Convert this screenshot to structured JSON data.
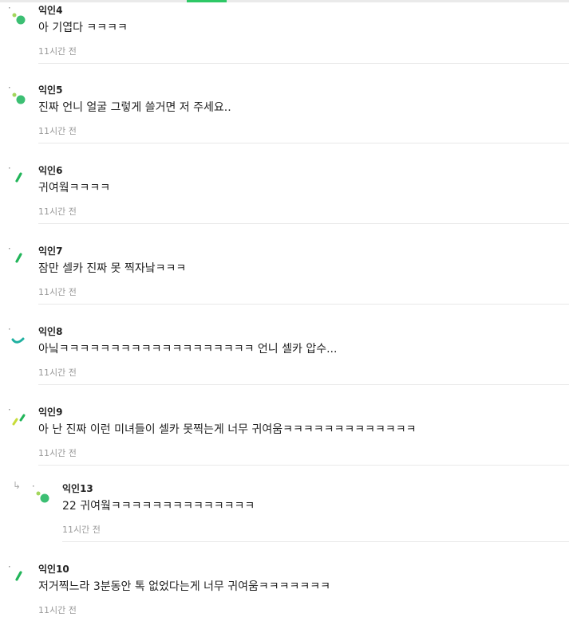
{
  "comments": [
    {
      "author": "익인4",
      "text": "아 기엽다 ㅋㅋㅋㅋ",
      "time": "11시간 전",
      "avatar": "dots-avatar-icon"
    },
    {
      "author": "익인5",
      "text": "진짜 언니 얼굴 그렇게 쓸거면 저 주세요..",
      "time": "11시간 전",
      "avatar": "dots-avatar-icon"
    },
    {
      "author": "익인6",
      "text": "귀여웤ㅋㅋㅋㅋ",
      "time": "11시간 전",
      "avatar": "slash-avatar-icon"
    },
    {
      "author": "익인7",
      "text": "잠만 셀카 진짜 못 찍자낰ㅋㅋㅋ",
      "time": "11시간 전",
      "avatar": "slash-avatar-icon"
    },
    {
      "author": "익인8",
      "text": "아닠ㅋㅋㅋㅋㅋㅋㅋㅋㅋㅋㅋㅋㅋㅋㅋㅋㅋㅋㅋ 언니 셀카 압수...",
      "time": "11시간 전",
      "avatar": "arc-avatar-icon"
    },
    {
      "author": "익인9",
      "text": "아 난 진짜 이런 미녀들이 셀카 못찍는게 너무 귀여움ㅋㅋㅋㅋㅋㅋㅋㅋㅋㅋㅋㅋㅋ",
      "time": "11시간 전",
      "avatar": "double-slash-avatar-icon"
    },
    {
      "author": "익인13",
      "text": "22 귀여웤ㅋㅋㅋㅋㅋㅋㅋㅋㅋㅋㅋㅋㅋㅋ",
      "time": "11시간 전",
      "avatar": "dots-avatar-icon",
      "is_reply": true
    },
    {
      "author": "익인10",
      "text": "저거찍느라 3분동안 톡 없었다는게 너무 귀여움ㅋㅋㅋㅋㅋㅋㅋ",
      "time": "11시간 전",
      "avatar": "slash-avatar-icon"
    }
  ],
  "colors": {
    "accent": "#2ec866",
    "accent_light": "#a3d65c",
    "muted": "#999999",
    "divider": "#e9e9e9"
  }
}
